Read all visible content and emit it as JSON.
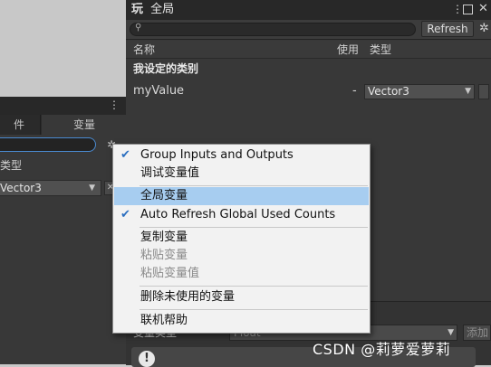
{
  "left_panel": {
    "tabs": [
      "件",
      "变量"
    ],
    "type_header": "类型",
    "dropdown_value": "Vector3",
    "remove_glyph": "✕"
  },
  "main_panel": {
    "tab_title": "全局",
    "tab_icon": "玩",
    "search_icon": "search-icon",
    "refresh_label": "Refresh",
    "columns": {
      "name": "名称",
      "used": "使用",
      "type": "类型"
    },
    "category": "我设定的类别",
    "variable": {
      "name": "myValue",
      "used": "-",
      "type": "Vector3"
    },
    "bottom": {
      "label": "变量类型",
      "field": "Float",
      "add": "添加"
    }
  },
  "context_menu": {
    "items": [
      {
        "label": "Group Inputs and Outputs",
        "checked": true,
        "disabled": false,
        "highlighted": false
      },
      {
        "label": "调试变量值",
        "checked": false,
        "disabled": false,
        "highlighted": false
      },
      {
        "label": "全局变量",
        "checked": false,
        "disabled": false,
        "highlighted": true
      },
      {
        "label": "Auto Refresh Global Used Counts",
        "checked": true,
        "disabled": false,
        "highlighted": false
      },
      {
        "label": "复制变量",
        "checked": false,
        "disabled": false,
        "highlighted": false
      },
      {
        "label": "粘贴变量",
        "checked": false,
        "disabled": true,
        "highlighted": false
      },
      {
        "label": "粘贴变量值",
        "checked": false,
        "disabled": true,
        "highlighted": false
      },
      {
        "label": "删除未使用的变量",
        "checked": false,
        "disabled": false,
        "highlighted": false
      },
      {
        "label": "联机帮助",
        "checked": false,
        "disabled": false,
        "highlighted": false
      }
    ]
  },
  "watermark": "CSDN @莉萝爱萝莉",
  "colors": {
    "menu_highlight": "#a7cdf0",
    "check": "#2b6fc0",
    "panel_bg": "#383838"
  }
}
